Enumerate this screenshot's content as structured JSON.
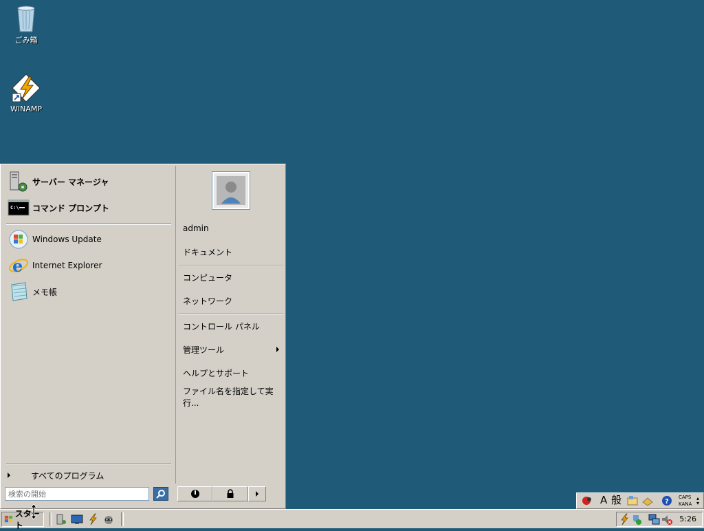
{
  "desktop": {
    "icons": [
      {
        "label": "ごみ箱",
        "icon": "recycle-bin-icon"
      },
      {
        "label": "WINAMP",
        "icon": "winamp-icon"
      }
    ]
  },
  "start_menu": {
    "pinned": [
      {
        "label": "サーバー マネージャ",
        "icon": "server-manager-icon"
      },
      {
        "label": "コマンド プロンプト",
        "icon": "command-prompt-icon"
      }
    ],
    "recent": [
      {
        "label": "Windows Update",
        "icon": "windows-update-icon"
      },
      {
        "label": "Internet Explorer",
        "icon": "internet-explorer-icon"
      },
      {
        "label": "メモ帳",
        "icon": "notepad-icon"
      }
    ],
    "all_programs": "すべてのプログラム",
    "search_placeholder": "検索の開始",
    "right": {
      "user": "admin",
      "documents": "ドキュメント",
      "computer": "コンピュータ",
      "network": "ネットワーク",
      "control_panel": "コントロール パネル",
      "admin_tools": "管理ツール",
      "help": "ヘルプとサポート",
      "run": "ファイル名を指定して実行..."
    }
  },
  "taskbar": {
    "start_label": "スタート",
    "clock": "5:26",
    "caps": "CAPS",
    "kana": "KANA",
    "ime_mode": "A",
    "ime_conv": "般"
  },
  "colors": {
    "desktop": "#1f5b78",
    "menu": "#d4d0c8"
  }
}
